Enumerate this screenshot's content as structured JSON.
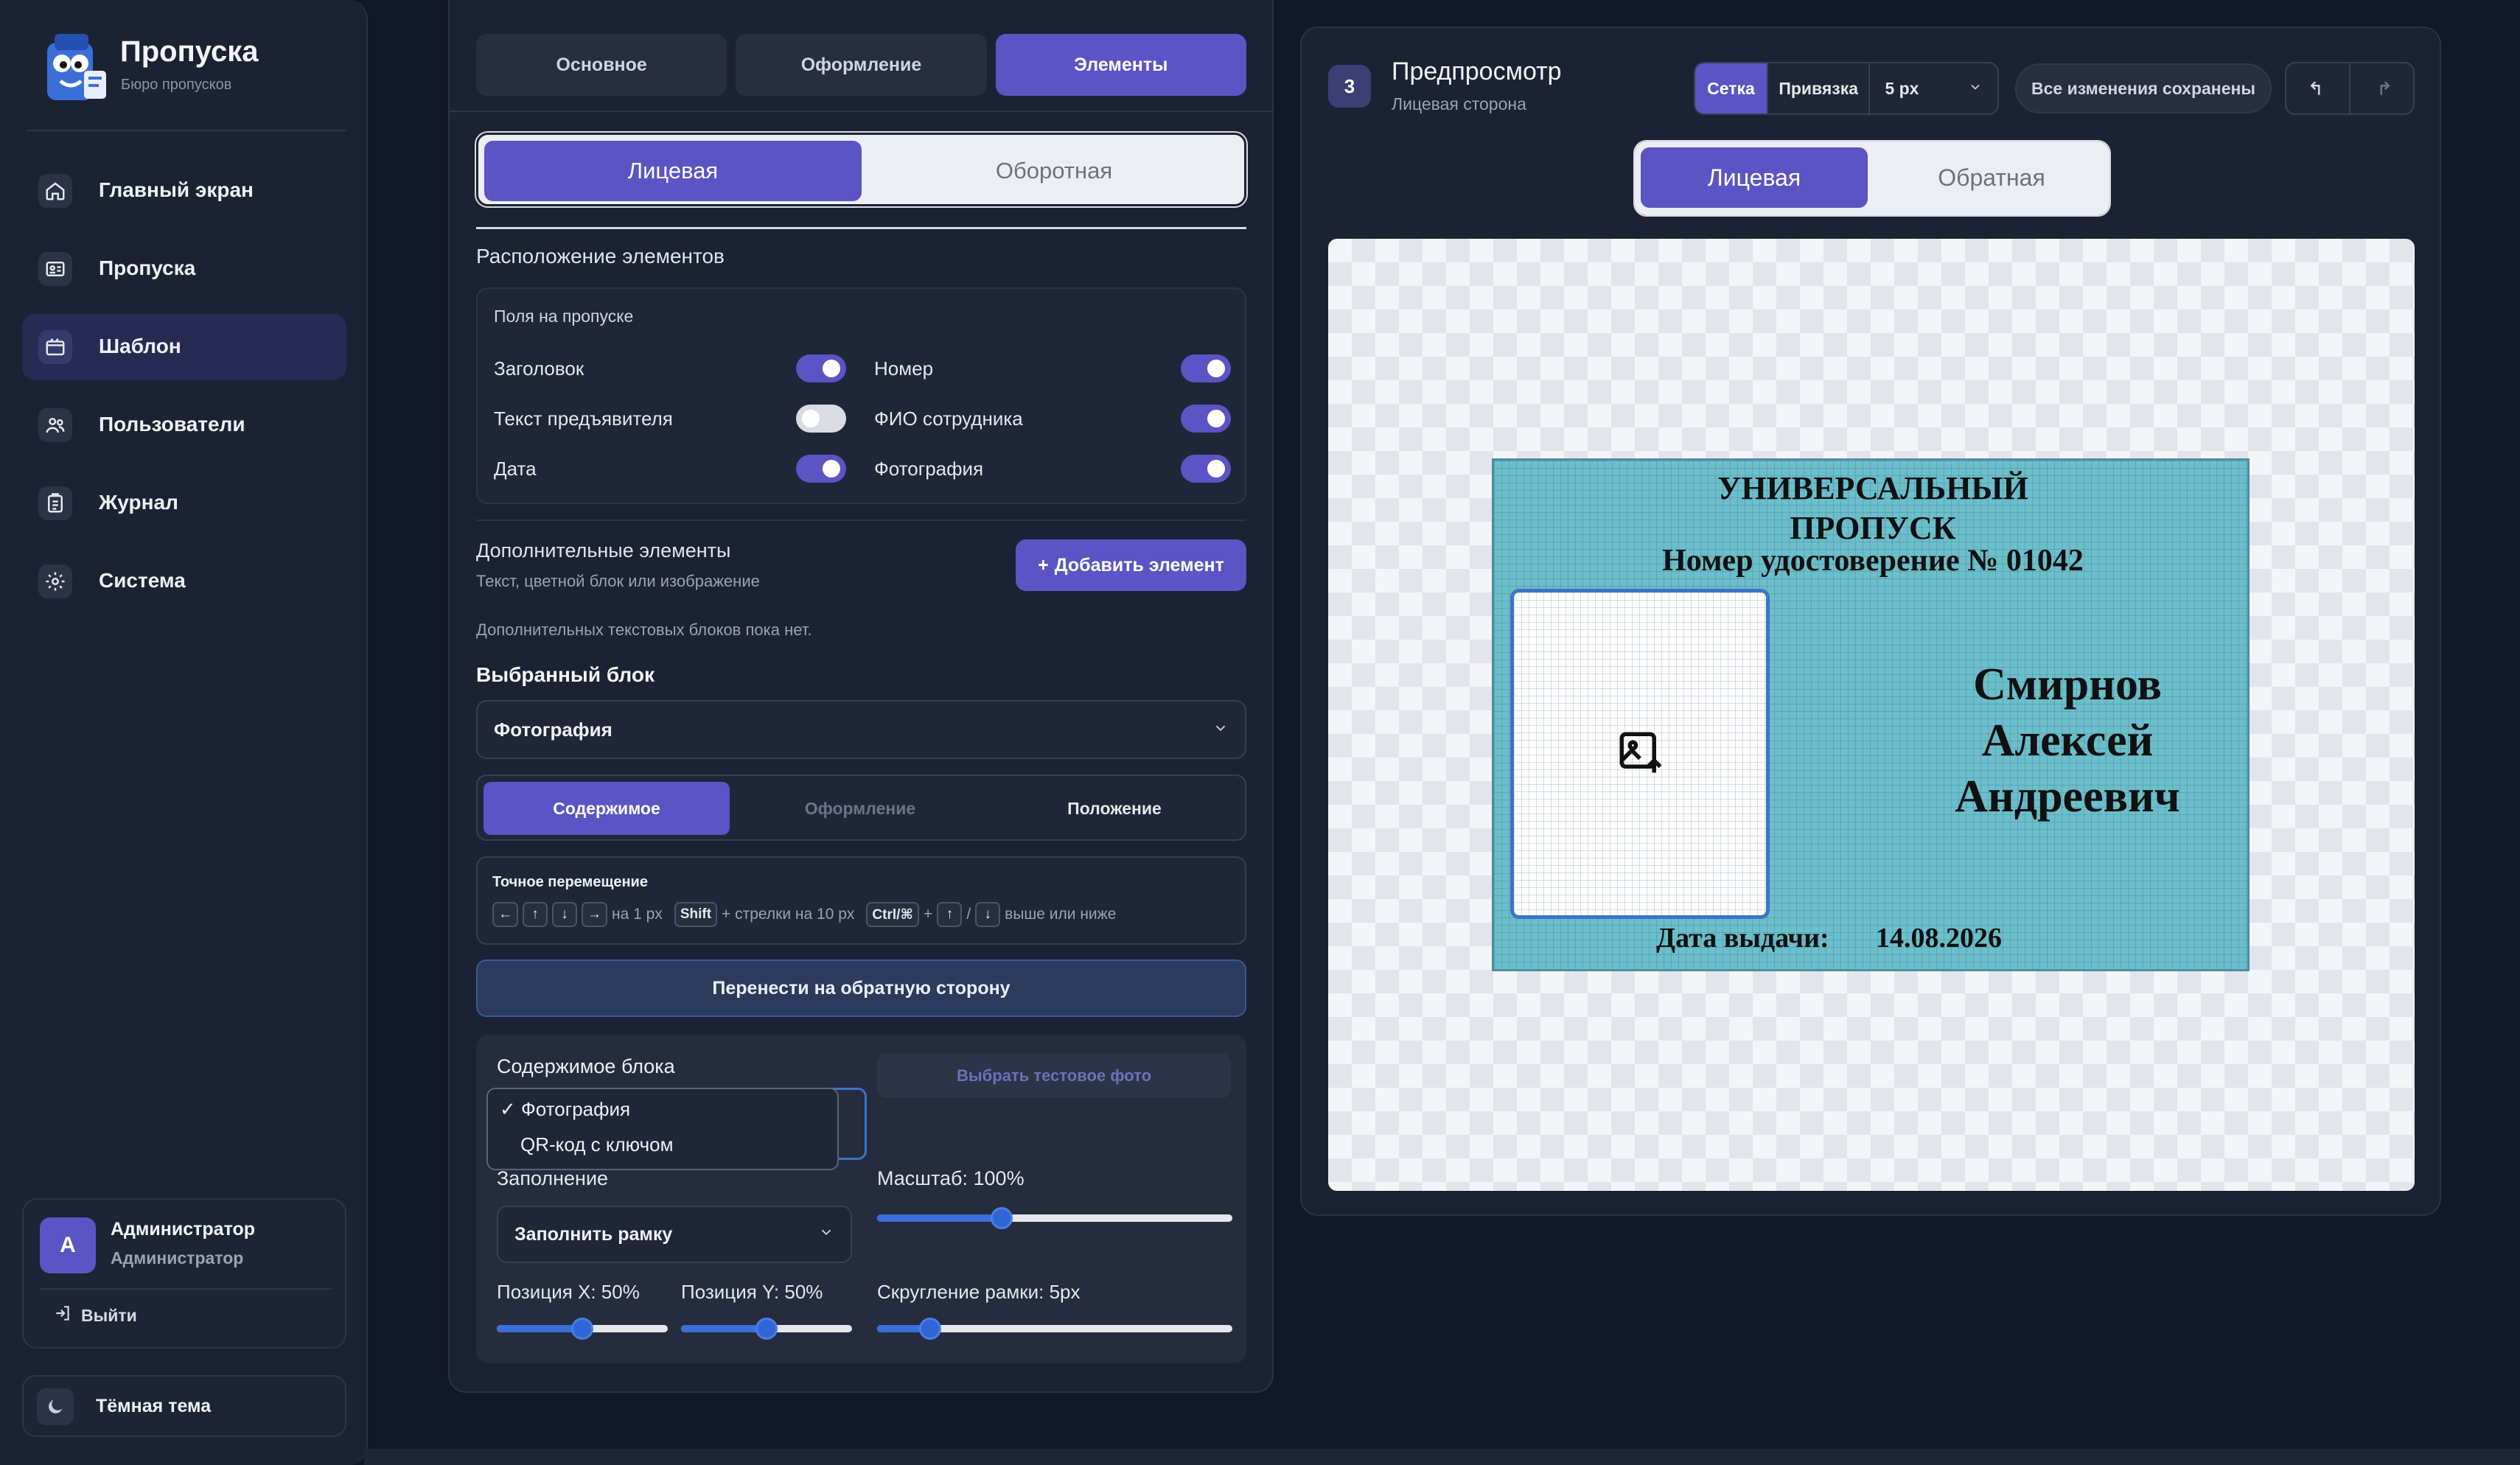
{
  "brand": {
    "name": "Пропуска",
    "subtitle": "Бюро пропусков"
  },
  "nav": [
    {
      "label": "Главный экран",
      "icon": "home-icon"
    },
    {
      "label": "Пропуска",
      "icon": "id-card-icon"
    },
    {
      "label": "Шаблон",
      "icon": "template-icon",
      "active": true
    },
    {
      "label": "Пользователи",
      "icon": "users-icon"
    },
    {
      "label": "Журнал",
      "icon": "journal-icon"
    },
    {
      "label": "Система",
      "icon": "gear-icon"
    }
  ],
  "user": {
    "initial": "А",
    "name": "Администратор",
    "role": "Администратор",
    "logout": "Выйти"
  },
  "theme": {
    "label": "Тёмная тема"
  },
  "editor": {
    "tabs": [
      "Основное",
      "Оформление",
      "Элементы"
    ],
    "active_tab": "Элементы",
    "sides": {
      "front": "Лицевая",
      "back": "Оборотная"
    },
    "layout_title": "Расположение элементов",
    "fields_title": "Поля на пропуске",
    "fields": [
      {
        "label": "Заголовок",
        "on": true
      },
      {
        "label": "Номер",
        "on": true
      },
      {
        "label": "Текст предъявителя",
        "on": false
      },
      {
        "label": "ФИО сотрудника",
        "on": true
      },
      {
        "label": "Дата",
        "on": true
      },
      {
        "label": "Фотография",
        "on": true
      }
    ],
    "extra_title": "Дополнительные элементы",
    "extra_sub": "Текст, цветной блок или изображение",
    "add_button": "Добавить элемент",
    "extra_empty": "Дополнительных текстовых блоков пока нет.",
    "selected_title": "Выбранный блок",
    "selected_value": "Фотография",
    "subtabs": [
      "Содержимое",
      "Оформление",
      "Положение"
    ],
    "precise": {
      "title": "Точное перемещение",
      "t1": "на 1 px",
      "shift": "Shift",
      "t2": "+ стрелки на 10 px",
      "ctrl": "Ctrl/⌘",
      "plus": "+",
      "slash": "/",
      "t3": "выше или ниже"
    },
    "move_button": "Перенести на обратную сторону",
    "content": {
      "title": "Содержимое блока",
      "test_photo": "Выбрать тестовое фото",
      "options": [
        "✓ Фотография",
        "QR-код с ключом"
      ],
      "fill_label": "Заполнение",
      "fill_value": "Заполнить рамку",
      "scale_label": "Масштаб: 100%",
      "scale_value": 0.35,
      "posx_label": "Позиция X: 50%",
      "posx_value": 0.5,
      "posy_label": "Позиция Y: 50%",
      "posy_value": 0.5,
      "radius_label": "Скругление рамки: 5px",
      "radius_value": 0.15
    }
  },
  "preview": {
    "step": "3",
    "title": "Предпросмотр",
    "subtitle": "Лицевая сторона",
    "grid": "Сетка",
    "snap": "Привязка",
    "snap_size": "5 px",
    "saved": "Все изменения сохранены",
    "face_front": "Лицевая",
    "face_back": "Обратная",
    "card": {
      "title1": "УНИВЕРСАЛЬНЫЙ",
      "title2": "ПРОПУСК",
      "number": "Номер удостоверение №  01042",
      "name1": "Смирнов",
      "name2": "Алексей",
      "name3": "Андреевич",
      "date_label": "Дата выдачи:",
      "date_value": "14.08.2026"
    }
  },
  "colors": {
    "accent": "#5b54c4",
    "card": "#6bbfcb",
    "slider": "#2f66d6"
  }
}
